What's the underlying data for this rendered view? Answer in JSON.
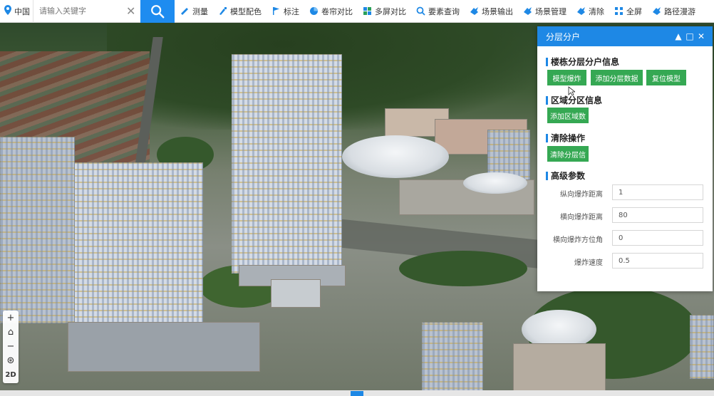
{
  "toolbar": {
    "location": "中国",
    "search_placeholder": "请输入关键字",
    "tools": [
      {
        "label": "测量",
        "icon": "ruler-icon"
      },
      {
        "label": "模型配色",
        "icon": "paint-icon"
      },
      {
        "label": "标注",
        "icon": "flag-icon"
      },
      {
        "label": "卷帘对比",
        "icon": "pie-icon"
      },
      {
        "label": "多屏对比",
        "icon": "grid-icon"
      },
      {
        "label": "要素查询",
        "icon": "search-icon"
      },
      {
        "label": "场景输出",
        "icon": "export-icon"
      },
      {
        "label": "场景管理",
        "icon": "manage-icon"
      },
      {
        "label": "清除",
        "icon": "eraser-icon"
      },
      {
        "label": "全屏",
        "icon": "fullscreen-icon"
      },
      {
        "label": "路径漫游",
        "icon": "route-icon"
      }
    ]
  },
  "nav": {
    "twod_label": "2D"
  },
  "panel": {
    "title": "分层分户",
    "sections": {
      "floor": {
        "title": "楼栋分层分户信息",
        "buttons": [
          "模型爆炸",
          "添加分层数据",
          "复位模型"
        ]
      },
      "zone": {
        "title": "区域分区信息",
        "button": "添加区域数"
      },
      "clear": {
        "title": "清除操作",
        "button": "清除分层信"
      },
      "advanced": {
        "title": "高级参数",
        "params": [
          {
            "label": "纵向爆炸距离",
            "value": "1"
          },
          {
            "label": "横向爆炸距离",
            "value": "80"
          },
          {
            "label": "横向爆炸方位角",
            "value": "0"
          },
          {
            "label": "爆炸速度",
            "value": "0.5"
          }
        ]
      }
    }
  },
  "watermark": "Ma",
  "colors": {
    "accent": "#1e88e5",
    "button_green": "#35a853"
  }
}
